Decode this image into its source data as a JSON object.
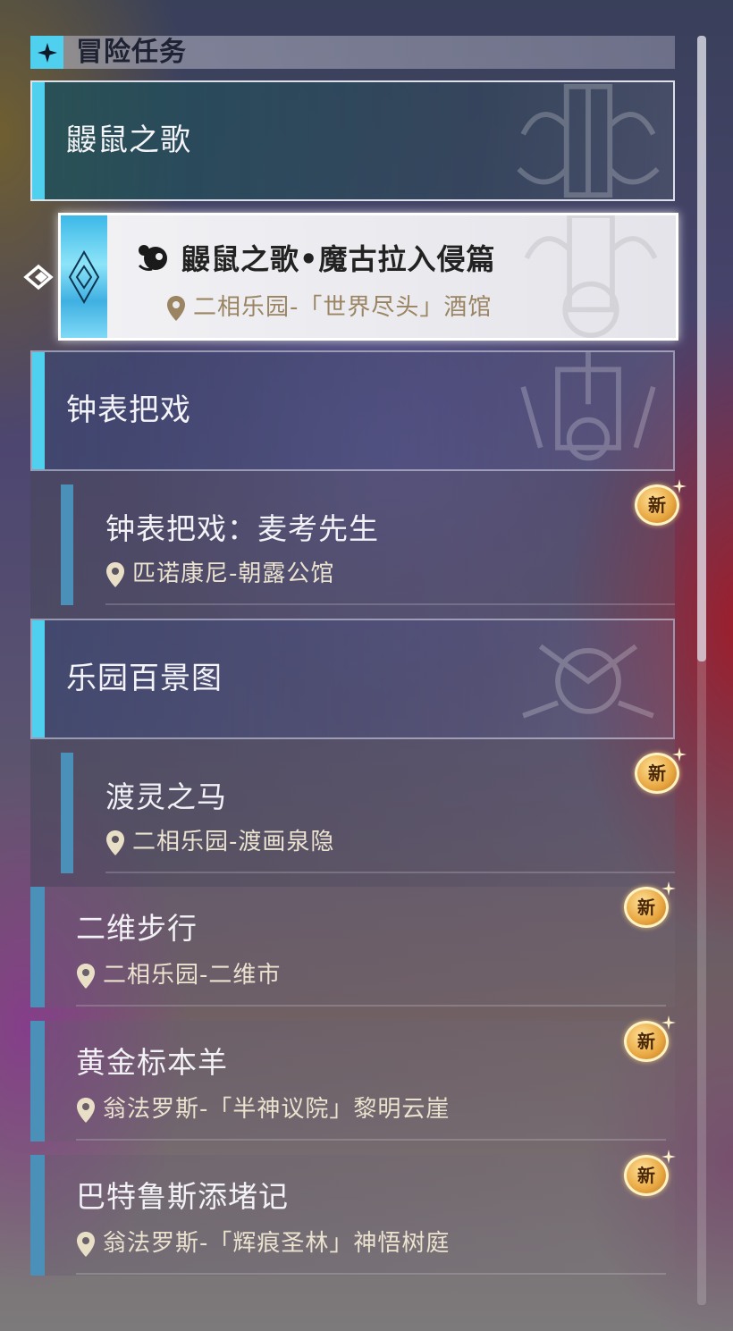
{
  "header": {
    "title": "冒险任务"
  },
  "categories": [
    {
      "title": "鼹鼠之歌"
    },
    {
      "title": "钟表把戏"
    },
    {
      "title": "乐园百景图"
    }
  ],
  "selected_quest": {
    "title": "鼹鼠之歌•魔古拉入侵篇",
    "location": "二相乐园-「世界尽头」酒馆"
  },
  "sub_quests": [
    {
      "title": "钟表把戏：麦考先生",
      "location": "匹诺康尼-朝露公馆",
      "badge": "新"
    },
    {
      "title": "渡灵之马",
      "location": "二相乐园-渡画泉隐",
      "badge": "新"
    }
  ],
  "quests": [
    {
      "title": "二维步行",
      "location": "二相乐园-二维市",
      "badge": "新"
    },
    {
      "title": "黄金标本羊",
      "location": "翁法罗斯-「半神议院」黎明云崖",
      "badge": "新"
    },
    {
      "title": "巴特鲁斯添堵记",
      "location": "翁法罗斯-「辉痕圣林」神悟树庭",
      "badge": "新"
    }
  ],
  "colors": {
    "accent": "#4fd0ee",
    "sub_bar": "#4a90b8",
    "badge": "#e8a640",
    "location_text": "#ebe3cf"
  },
  "icons": {
    "header": "four-point-star-icon",
    "pointer": "double-chevron-pointer-icon",
    "quest_type": "mole-quest-icon",
    "location": "location-pin-icon",
    "new_badge": "new-badge-icon"
  }
}
